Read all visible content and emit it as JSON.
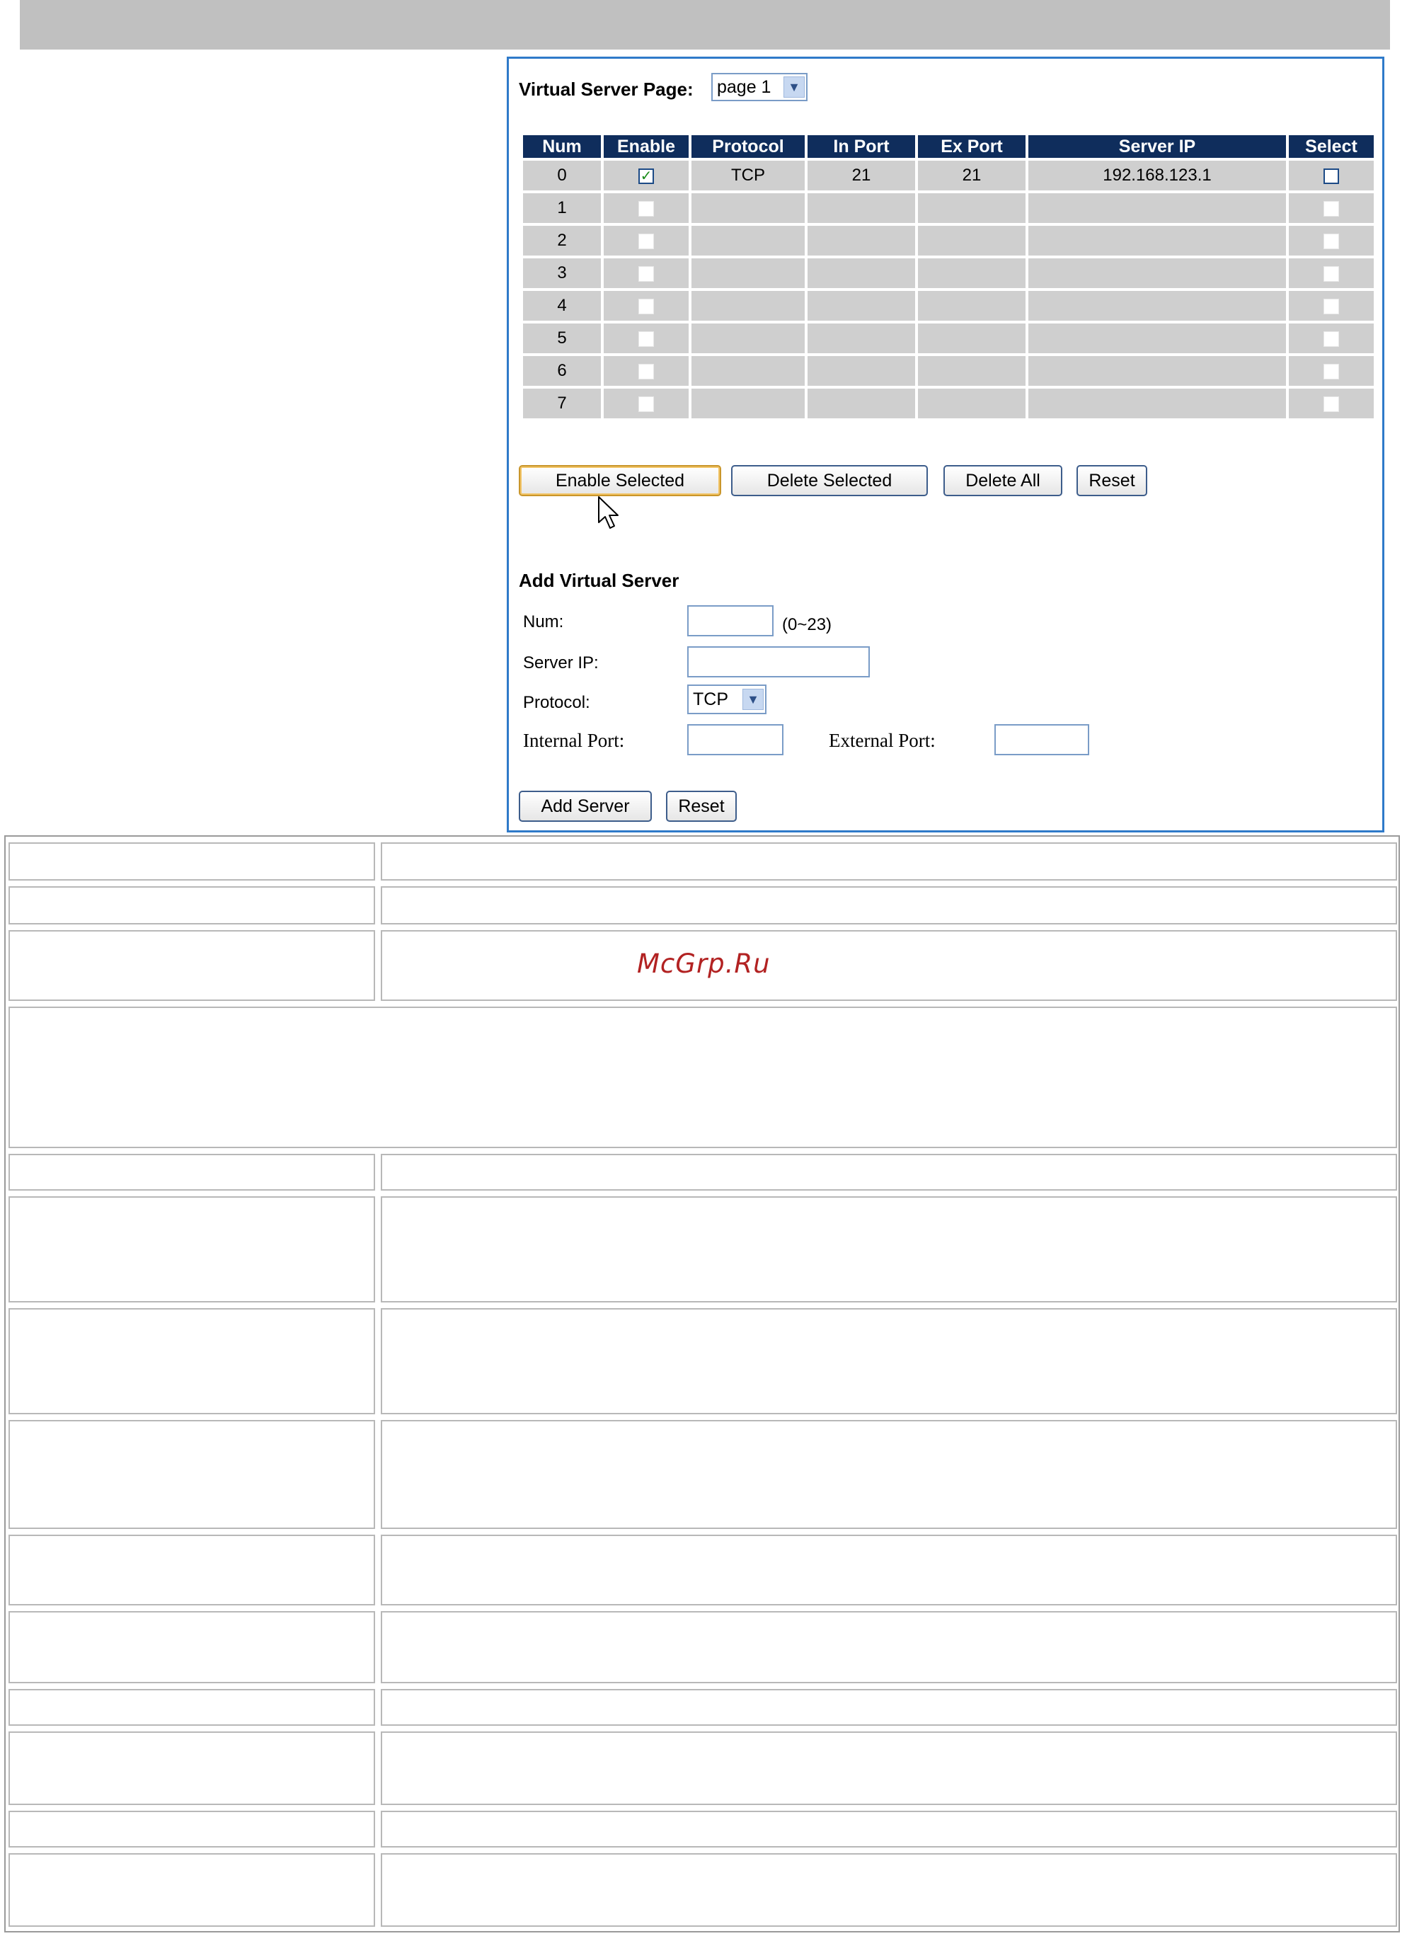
{
  "page_select": {
    "label": "Virtual Server Page:",
    "value": "page 1"
  },
  "table": {
    "headers": [
      "Num",
      "Enable",
      "Protocol",
      "In Port",
      "Ex Port",
      "Server IP",
      "Select"
    ],
    "rows": [
      {
        "num": "0",
        "enabled": true,
        "protocol": "TCP",
        "in_port": "21",
        "ex_port": "21",
        "server_ip": "192.168.123.1"
      },
      {
        "num": "1",
        "enabled": false,
        "protocol": "",
        "in_port": "",
        "ex_port": "",
        "server_ip": ""
      },
      {
        "num": "2",
        "enabled": false,
        "protocol": "",
        "in_port": "",
        "ex_port": "",
        "server_ip": ""
      },
      {
        "num": "3",
        "enabled": false,
        "protocol": "",
        "in_port": "",
        "ex_port": "",
        "server_ip": ""
      },
      {
        "num": "4",
        "enabled": false,
        "protocol": "",
        "in_port": "",
        "ex_port": "",
        "server_ip": ""
      },
      {
        "num": "5",
        "enabled": false,
        "protocol": "",
        "in_port": "",
        "ex_port": "",
        "server_ip": ""
      },
      {
        "num": "6",
        "enabled": false,
        "protocol": "",
        "in_port": "",
        "ex_port": "",
        "server_ip": ""
      },
      {
        "num": "7",
        "enabled": false,
        "protocol": "",
        "in_port": "",
        "ex_port": "",
        "server_ip": ""
      }
    ]
  },
  "actions": {
    "enable_selected": "Enable Selected",
    "delete_selected": "Delete Selected",
    "delete_all": "Delete All",
    "reset": "Reset"
  },
  "add_form": {
    "title": "Add Virtual Server",
    "num_label": "Num:",
    "num_value": "",
    "num_hint": "(0~23)",
    "server_ip_label": "Server IP:",
    "server_ip_value": "",
    "protocol_label": "Protocol:",
    "protocol_value": "TCP",
    "internal_port_label": "Internal Port:",
    "internal_port_value": "",
    "external_port_label": "External Port:",
    "external_port_value": "",
    "add_button": "Add Server",
    "reset_button": "Reset"
  },
  "icons": {
    "cursor": "mouse-pointer-icon",
    "dropdown": "chevron-down-icon",
    "check": "checkmark-icon"
  },
  "colors": {
    "header_bg": "#0f2d5c",
    "row_bg": "#cfcfcf",
    "panel_border": "#2f7ac9",
    "watermark": "#b22222"
  },
  "watermark": "McGrp.Ru"
}
